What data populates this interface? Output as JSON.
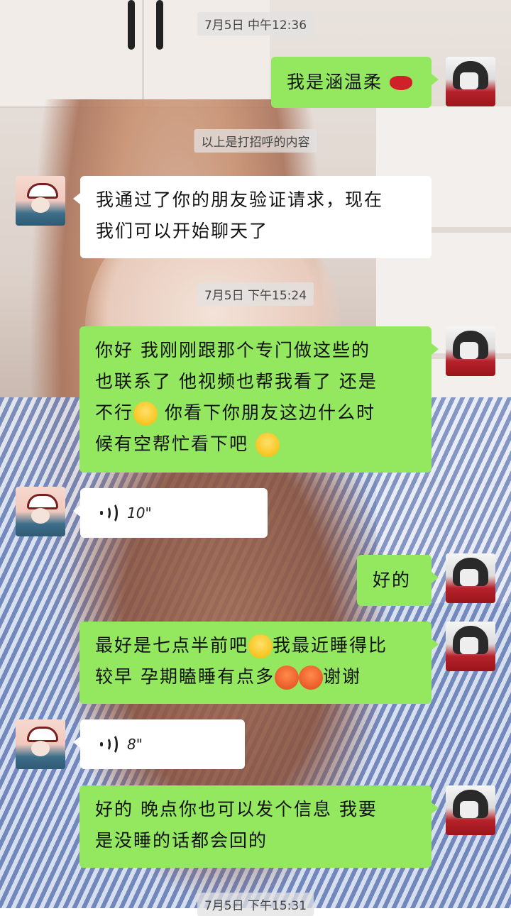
{
  "timestamps": [
    "7月5日 中午12:36",
    "7月5日 下午15:24",
    "7月5日 下午15:31"
  ],
  "system_notice": "以上是打招呼的内容",
  "messages": [
    {
      "from": "me",
      "text": "我是涵温柔",
      "emoji": "lips"
    },
    {
      "from": "them",
      "line1": "我通过了你的朋友验证请求，现在",
      "line2": "我们可以开始聊天了"
    },
    {
      "from": "me",
      "line1": "你好  我刚刚跟那个专门做这些的",
      "line2": "也联系了  他视频也帮我看了  还是",
      "line3a": "不行",
      "line3b": "  你看下你朋友这边什么时",
      "line4": "候有空帮忙看下吧"
    },
    {
      "from": "them",
      "voice_duration": "10\""
    },
    {
      "from": "me",
      "text": "好的"
    },
    {
      "from": "me",
      "line1a": "最好是七点半前吧",
      "line1b": "我最近睡得比",
      "line2a": "较早  孕期瞌睡有点多",
      "line2b": "谢谢"
    },
    {
      "from": "them",
      "voice_duration": "8\""
    },
    {
      "from": "me",
      "line1": "好的  晚点你也可以发个信息  我要",
      "line2": "是没睡的话都会回的"
    }
  ],
  "colors": {
    "bubble_me": "#93e85f",
    "bubble_them": "#ffffff"
  },
  "icons": {
    "voice": "voice-wave-icon",
    "lips": "kiss-lips-emoji",
    "smile": "smile-emoji",
    "angry": "angry-emoji"
  }
}
